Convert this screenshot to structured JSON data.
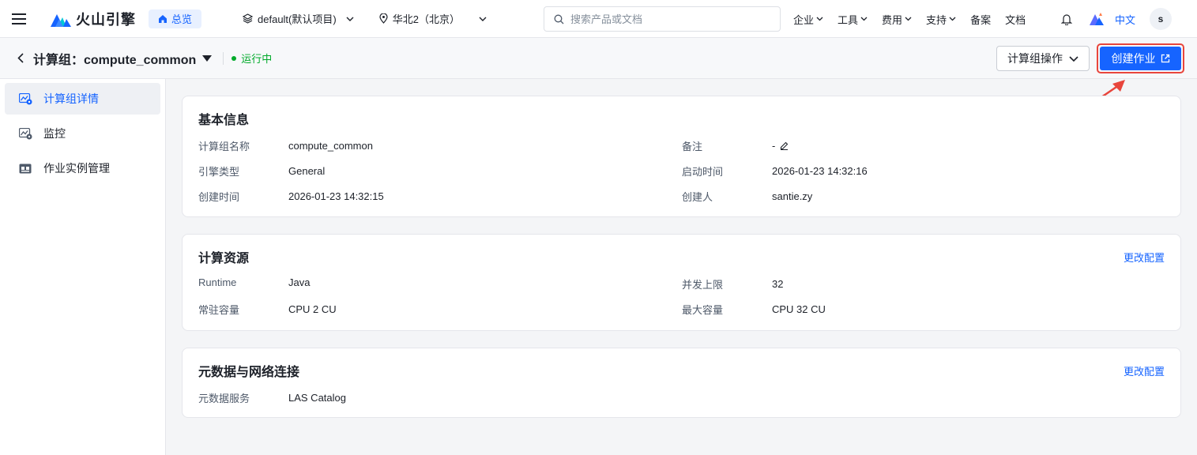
{
  "brand": {
    "name": "火山引擎"
  },
  "nav": {
    "home_label": "总览",
    "project_label": "default(默认项目)",
    "region_label": "华北2（北京）",
    "search_placeholder": "搜索产品或文档",
    "menu": [
      {
        "label": "企业"
      },
      {
        "label": "工具"
      },
      {
        "label": "费用"
      },
      {
        "label": "支持"
      },
      {
        "label": "备案"
      },
      {
        "label": "文档"
      }
    ],
    "lang_label": "中文",
    "avatar_initial": "s"
  },
  "header": {
    "title": "计算组：compute_common",
    "status": "运行中",
    "ops_button": "计算组操作",
    "create_button": "创建作业"
  },
  "sidebar": {
    "items": [
      {
        "label": "计算组详情",
        "icon": "compute-detail-icon",
        "active": true
      },
      {
        "label": "监控",
        "icon": "monitor-icon",
        "active": false
      },
      {
        "label": "作业实例管理",
        "icon": "job-instance-icon",
        "active": false
      }
    ]
  },
  "basic_info": {
    "title": "基本信息",
    "fields": [
      {
        "label": "计算组名称",
        "value": "compute_common"
      },
      {
        "label": "备注",
        "value": "-"
      },
      {
        "label": "引擎类型",
        "value": "General"
      },
      {
        "label": "启动时间",
        "value": "2026-01-23 14:32:16"
      },
      {
        "label": "创建时间",
        "value": "2026-01-23 14:32:15"
      },
      {
        "label": "创建人",
        "value": "santie.zy"
      }
    ]
  },
  "compute_resources": {
    "title": "计算资源",
    "link": "更改配置",
    "fields": [
      {
        "label": "Runtime",
        "value": "Java"
      },
      {
        "label": "并发上限",
        "value": "32"
      },
      {
        "label": "常驻容量",
        "value": "CPU 2 CU"
      },
      {
        "label": "最大容量",
        "value": "CPU 32 CU"
      }
    ]
  },
  "metadata_network": {
    "title": "元数据与网络连接",
    "link": "更改配置",
    "fields": [
      {
        "label": "元数据服务",
        "value": "LAS Catalog"
      }
    ]
  },
  "colors": {
    "primary": "#1664ff",
    "running": "#00aa2a",
    "highlight": "#e8453c"
  }
}
